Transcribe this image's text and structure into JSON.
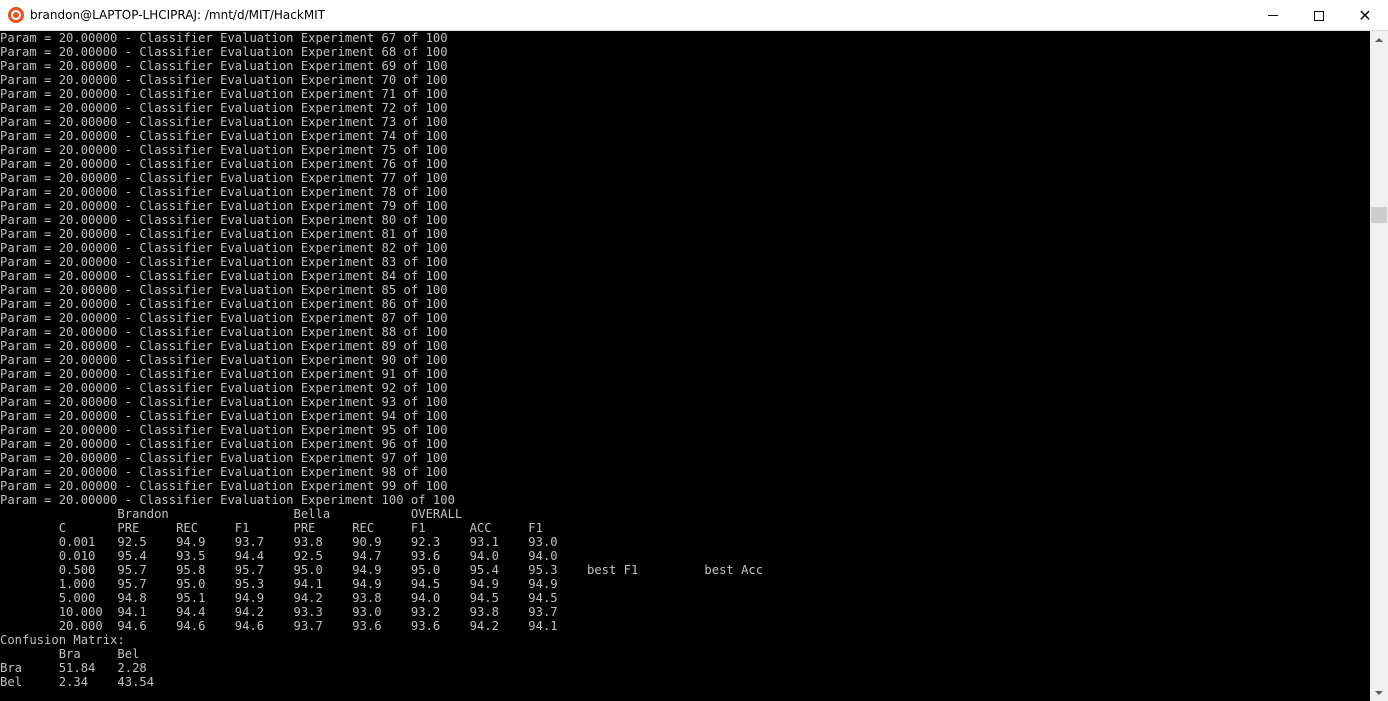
{
  "window": {
    "title": "brandon@LAPTOP-LHCIPRAJ: /mnt/d/MIT/HackMIT",
    "icon": "ubuntu-icon",
    "close_glyph": "✕"
  },
  "colors": {
    "terminal_bg": "#000000",
    "terminal_fg": "#c0c0c0",
    "titlebar_bg": "#ffffff",
    "ubuntu_orange": "#e95420"
  },
  "terminal": {
    "lines": [
      "Param = 20.00000 - Classifier Evaluation Experiment 67 of 100",
      "Param = 20.00000 - Classifier Evaluation Experiment 68 of 100",
      "Param = 20.00000 - Classifier Evaluation Experiment 69 of 100",
      "Param = 20.00000 - Classifier Evaluation Experiment 70 of 100",
      "Param = 20.00000 - Classifier Evaluation Experiment 71 of 100",
      "Param = 20.00000 - Classifier Evaluation Experiment 72 of 100",
      "Param = 20.00000 - Classifier Evaluation Experiment 73 of 100",
      "Param = 20.00000 - Classifier Evaluation Experiment 74 of 100",
      "Param = 20.00000 - Classifier Evaluation Experiment 75 of 100",
      "Param = 20.00000 - Classifier Evaluation Experiment 76 of 100",
      "Param = 20.00000 - Classifier Evaluation Experiment 77 of 100",
      "Param = 20.00000 - Classifier Evaluation Experiment 78 of 100",
      "Param = 20.00000 - Classifier Evaluation Experiment 79 of 100",
      "Param = 20.00000 - Classifier Evaluation Experiment 80 of 100",
      "Param = 20.00000 - Classifier Evaluation Experiment 81 of 100",
      "Param = 20.00000 - Classifier Evaluation Experiment 82 of 100",
      "Param = 20.00000 - Classifier Evaluation Experiment 83 of 100",
      "Param = 20.00000 - Classifier Evaluation Experiment 84 of 100",
      "Param = 20.00000 - Classifier Evaluation Experiment 85 of 100",
      "Param = 20.00000 - Classifier Evaluation Experiment 86 of 100",
      "Param = 20.00000 - Classifier Evaluation Experiment 87 of 100",
      "Param = 20.00000 - Classifier Evaluation Experiment 88 of 100",
      "Param = 20.00000 - Classifier Evaluation Experiment 89 of 100",
      "Param = 20.00000 - Classifier Evaluation Experiment 90 of 100",
      "Param = 20.00000 - Classifier Evaluation Experiment 91 of 100",
      "Param = 20.00000 - Classifier Evaluation Experiment 92 of 100",
      "Param = 20.00000 - Classifier Evaluation Experiment 93 of 100",
      "Param = 20.00000 - Classifier Evaluation Experiment 94 of 100",
      "Param = 20.00000 - Classifier Evaluation Experiment 95 of 100",
      "Param = 20.00000 - Classifier Evaluation Experiment 96 of 100",
      "Param = 20.00000 - Classifier Evaluation Experiment 97 of 100",
      "Param = 20.00000 - Classifier Evaluation Experiment 98 of 100",
      "Param = 20.00000 - Classifier Evaluation Experiment 99 of 100",
      "Param = 20.00000 - Classifier Evaluation Experiment 100 of 100",
      "                Brandon                 Bella           OVERALL",
      "        C       PRE     REC     F1      PRE     REC     F1      ACC     F1",
      "        0.001   92.5    94.9    93.7    93.8    90.9    92.3    93.1    93.0",
      "        0.010   95.4    93.5    94.4    92.5    94.7    93.6    94.0    94.0",
      "        0.500   95.7    95.8    95.7    95.0    94.9    95.0    95.4    95.3    best F1         best Acc",
      "        1.000   95.7    95.0    95.3    94.1    94.9    94.5    94.9    94.9",
      "        5.000   94.8    95.1    94.9    94.2    93.8    94.0    94.5    94.5",
      "        10.000  94.1    94.4    94.2    93.3    93.0    93.2    93.8    93.7",
      "        20.000  94.6    94.6    94.6    93.7    93.6    93.6    94.2    94.1",
      "Confusion Matrix:",
      "        Bra     Bel",
      "Bra     51.84   2.28",
      "Bel     2.34    43.54"
    ]
  }
}
